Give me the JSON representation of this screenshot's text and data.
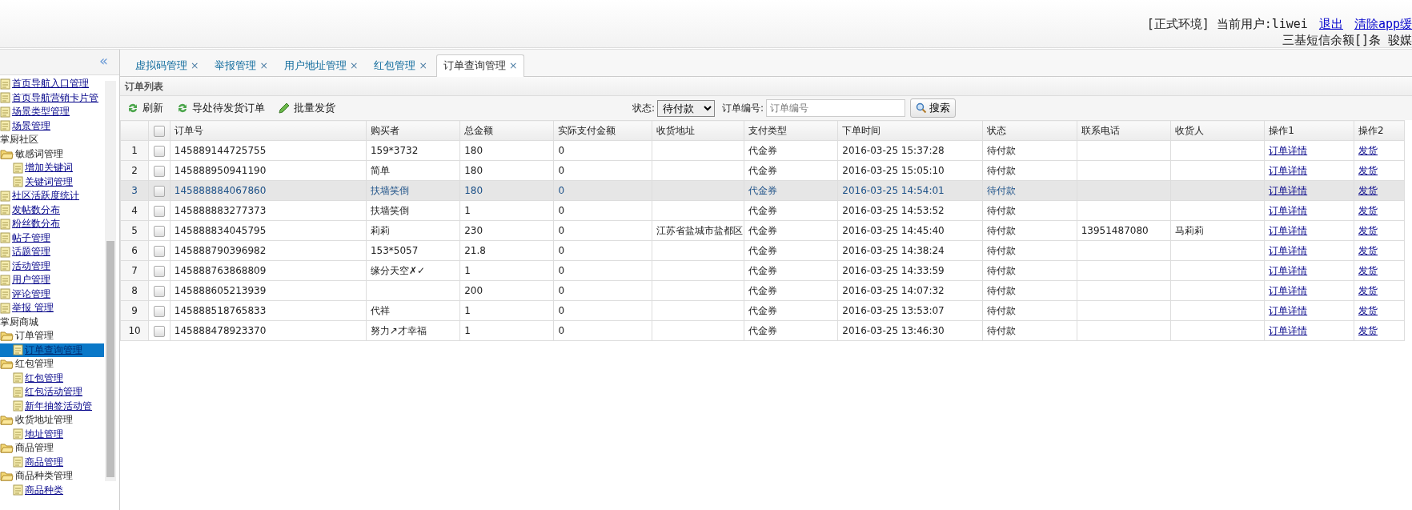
{
  "header": {
    "env": "[正式环境]",
    "user_label": "当前用户:liwei",
    "links": [
      "退出",
      "清除app缓"
    ],
    "sms_line": "三基短信余额[]条  骏媒"
  },
  "sidebar": {
    "collapse": "«",
    "sections": [
      {
        "items": [
          {
            "label": "首页导航入口管理",
            "kind": "page",
            "selected": false
          },
          {
            "label": "首页导航营销卡片管",
            "kind": "page",
            "selected": false
          },
          {
            "label": "场景类型管理",
            "kind": "page",
            "selected": false
          },
          {
            "label": "场景管理",
            "kind": "page",
            "selected": false
          }
        ]
      },
      {
        "title": "掌厨社区",
        "items": [
          {
            "label": "敏感词管理",
            "kind": "folder",
            "selected": false,
            "children": [
              {
                "label": "增加关键词",
                "kind": "page",
                "selected": false
              },
              {
                "label": "关键词管理",
                "kind": "page",
                "selected": false
              }
            ]
          },
          {
            "label": "社区活跃度统计",
            "kind": "page",
            "selected": false
          },
          {
            "label": "发帖数分布",
            "kind": "page",
            "selected": false
          },
          {
            "label": "粉丝数分布",
            "kind": "page",
            "selected": false
          },
          {
            "label": "帖子管理",
            "kind": "page",
            "selected": false
          },
          {
            "label": "话题管理",
            "kind": "page",
            "selected": false
          },
          {
            "label": "活动管理",
            "kind": "page",
            "selected": false
          },
          {
            "label": "用户管理",
            "kind": "page",
            "selected": false
          },
          {
            "label": "评论管理",
            "kind": "page",
            "selected": false
          },
          {
            "label": "举报 管理",
            "kind": "page",
            "selected": false
          }
        ]
      },
      {
        "title": "掌厨商城",
        "items": [
          {
            "label": "订单管理",
            "kind": "folder",
            "selected": false,
            "children": [
              {
                "label": "订单查询管理",
                "kind": "page",
                "selected": true
              }
            ]
          },
          {
            "label": "红包管理",
            "kind": "folder",
            "selected": false,
            "children": [
              {
                "label": "红包管理",
                "kind": "page",
                "selected": false
              },
              {
                "label": "红包活动管理",
                "kind": "page",
                "selected": false
              },
              {
                "label": "新年抽签活动管",
                "kind": "page",
                "selected": false
              }
            ]
          },
          {
            "label": "收货地址管理",
            "kind": "folder",
            "selected": false,
            "children": [
              {
                "label": "地址管理",
                "kind": "page",
                "selected": false
              }
            ]
          },
          {
            "label": "商品管理",
            "kind": "folder",
            "selected": false,
            "children": [
              {
                "label": "商品管理",
                "kind": "page",
                "selected": false
              }
            ]
          },
          {
            "label": "商品种类管理",
            "kind": "folder",
            "selected": false,
            "children": [
              {
                "label": "商品种类",
                "kind": "page",
                "selected": false
              }
            ]
          }
        ]
      }
    ]
  },
  "tabs": [
    {
      "label": "虚拟码管理",
      "close": "×",
      "selected": false
    },
    {
      "label": "举报管理",
      "close": "×",
      "selected": false
    },
    {
      "label": "用户地址管理",
      "close": "×",
      "selected": false
    },
    {
      "label": "红包管理",
      "close": "×",
      "selected": false
    },
    {
      "label": "订单查询管理",
      "close": "×",
      "selected": true
    }
  ],
  "panel_title": "订单列表",
  "toolbar": {
    "buttons": [
      {
        "label": "刷新",
        "kind": "refresh"
      },
      {
        "label": "导处待发货订单",
        "kind": "refresh"
      },
      {
        "label": "批量发货",
        "kind": "pencil"
      }
    ],
    "status_label": "状态:",
    "status_value": "待付款",
    "order_label": "订单编号:",
    "order_placeholder": "订单编号",
    "search": "搜索"
  },
  "table": {
    "select_all_checked": false,
    "columns": [
      "订单号",
      "购买者",
      "总金额",
      "实际支付金额",
      "收货地址",
      "支付类型",
      "下单时间",
      "状态",
      "联系电话",
      "收货人",
      "操作1",
      "操作2"
    ],
    "rows": [
      {
        "index": "1",
        "checked": false,
        "selected": false,
        "cells": [
          "145889144725755",
          "159*3732",
          "180",
          "0",
          "",
          "代金券",
          "2016-03-25 15:37:28",
          "待付款",
          "",
          "",
          "订单详情",
          "发货"
        ]
      },
      {
        "index": "2",
        "checked": false,
        "selected": false,
        "cells": [
          "145888950941190",
          "简单",
          "180",
          "0",
          "",
          "代金券",
          "2016-03-25 15:05:10",
          "待付款",
          "",
          "",
          "订单详情",
          "发货"
        ]
      },
      {
        "index": "3",
        "checked": false,
        "selected": true,
        "cells": [
          "145888884067860",
          "扶墙笑倒",
          "180",
          "0",
          "",
          "代金券",
          "2016-03-25 14:54:01",
          "待付款",
          "",
          "",
          "订单详情",
          "发货"
        ]
      },
      {
        "index": "4",
        "checked": false,
        "selected": false,
        "cells": [
          "145888883277373",
          "扶墙笑倒",
          "1",
          "0",
          "",
          "代金券",
          "2016-03-25 14:53:52",
          "待付款",
          "",
          "",
          "订单详情",
          "发货"
        ]
      },
      {
        "index": "5",
        "checked": false,
        "selected": false,
        "cells": [
          "145888834045795",
          "莉莉",
          "230",
          "0",
          "江苏省盐城市盐都区",
          "代金券",
          "2016-03-25 14:45:40",
          "待付款",
          "13951487080",
          "马莉莉",
          "订单详情",
          "发货"
        ]
      },
      {
        "index": "6",
        "checked": false,
        "selected": false,
        "cells": [
          "145888790396982",
          "153*5057",
          "21.8",
          "0",
          "",
          "代金券",
          "2016-03-25 14:38:24",
          "待付款",
          "",
          "",
          "订单详情",
          "发货"
        ]
      },
      {
        "index": "7",
        "checked": false,
        "selected": false,
        "cells": [
          "145888763868809",
          "缘分天空✗✓",
          "1",
          "0",
          "",
          "代金券",
          "2016-03-25 14:33:59",
          "待付款",
          "",
          "",
          "订单详情",
          "发货"
        ]
      },
      {
        "index": "8",
        "checked": false,
        "selected": false,
        "cells": [
          "145888605213939",
          "",
          "200",
          "0",
          "",
          "代金券",
          "2016-03-25 14:07:32",
          "待付款",
          "",
          "",
          "订单详情",
          "发货"
        ]
      },
      {
        "index": "9",
        "checked": false,
        "selected": false,
        "cells": [
          "145888518765833",
          "代祥",
          "1",
          "0",
          "",
          "代金券",
          "2016-03-25 13:53:07",
          "待付款",
          "",
          "",
          "订单详情",
          "发货"
        ]
      },
      {
        "index": "10",
        "checked": false,
        "selected": false,
        "cells": [
          "145888478923370",
          "努力↗才幸福",
          "1",
          "0",
          "",
          "代金券",
          "2016-03-25 13:46:30",
          "待付款",
          "",
          "",
          "订单详情",
          "发货"
        ]
      }
    ]
  }
}
